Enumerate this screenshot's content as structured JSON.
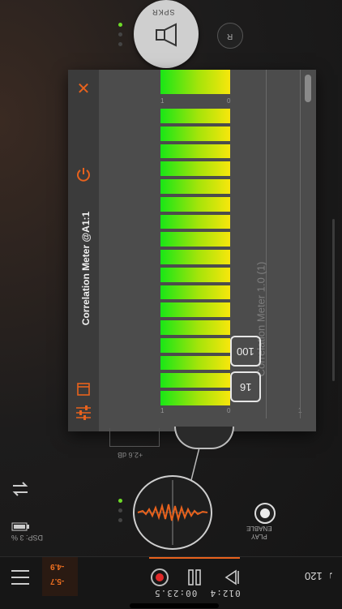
{
  "speaker": {
    "label": "SPKR",
    "r_label": "R"
  },
  "panel": {
    "title": "Correlation Meter @A1:1",
    "preset_name": "Correlation Meter 1.0 (1)",
    "scale_top": [
      "1",
      "0"
    ],
    "scale_bottom": [
      "1",
      "0",
      "1"
    ],
    "button_a": "100",
    "button_b": "16"
  },
  "meter": {
    "segments": 17,
    "fill_fraction": 1.0,
    "colors": {
      "low": "#19e616",
      "mid": "#a6e40a",
      "high": "#f7e60c"
    }
  },
  "gain": {
    "label": "+2.6 dB"
  },
  "status": {
    "dsp": "DSP: 3 %",
    "play_enable": "PLAY\nENABLE"
  },
  "levels": {
    "left": "-4.9",
    "right": "-5.7"
  },
  "transport": {
    "time": "012:4  00:23.5",
    "tempo": "♩120"
  },
  "accent_color": "#e8621d"
}
